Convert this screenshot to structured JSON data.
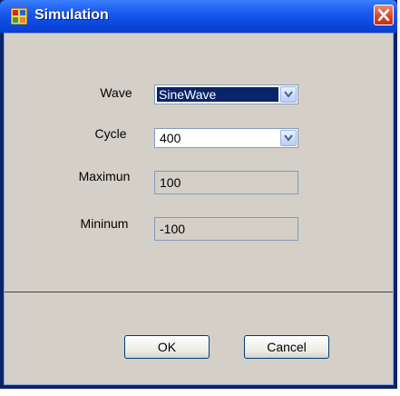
{
  "window": {
    "title": "Simulation"
  },
  "form": {
    "wave": {
      "label": "Wave",
      "value": "SineWave"
    },
    "cycle": {
      "label": "Cycle",
      "value": "400"
    },
    "maximum": {
      "label": "Maximun",
      "value": "100"
    },
    "minimum": {
      "label": "Mininum",
      "value": "-100"
    }
  },
  "buttons": {
    "ok": "OK",
    "cancel": "Cancel"
  },
  "icons": {
    "app": "app-window-icon",
    "close": "close-icon",
    "dropdown": "chevron-down-icon"
  },
  "colors": {
    "titlebar": "#0b4ae0",
    "client": "#d4d0c8",
    "selection": "#0a246a",
    "close": "#d9442a"
  }
}
